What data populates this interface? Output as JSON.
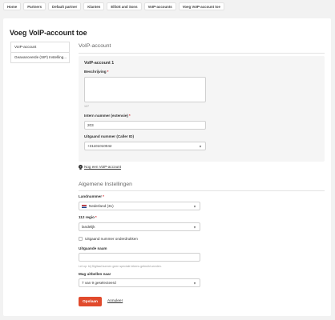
{
  "breadcrumb": [
    "Home",
    "Partners",
    "Default partner",
    "Klanten",
    "Elliott and Sons",
    "VoIP-accounts",
    "Voeg VoIP-account toe"
  ],
  "page_title": "Voeg VoIP-account toe",
  "sidebar": {
    "items": [
      {
        "label": "VoIP-account",
        "active": true
      },
      {
        "label": "Geavanceerde (SIP) Instelling...",
        "active": false
      }
    ]
  },
  "voip_section": {
    "title": "VoIP-account",
    "account_title": "VoIP-account 1",
    "description_label": "Beschrijving",
    "description_value": "",
    "description_count": "127",
    "internal_number_label": "Intern nummer (extensie)",
    "internal_number_value": "203",
    "outgoing_number_label": "Uitgaand nummer (Caller ID)",
    "outgoing_number_value": "+31101010042",
    "add_account_link": "Nog een VoIP-account"
  },
  "general_section": {
    "title": "Algemene Instellingen",
    "country_label": "Landnummer",
    "country_value": "Nederland (31)",
    "rule_112_label": "112 regio",
    "rule_112_value": "landelijk",
    "suppress_label": "Uitgaand nummer onderdrukken",
    "outgoing_name_label": "Uitgaande naam",
    "outgoing_name_value": "",
    "outgoing_name_hint": "Let op: bij Digitaal kunnen geen speciale tekens gebruikt worden.",
    "may_call_label": "Mag uitbellen naar",
    "may_call_value": "7 van 9 geselecteerd"
  },
  "actions": {
    "save_label": "Opslaan",
    "cancel_label": "Annuleer"
  },
  "colors": {
    "primary_button": "#e14a2c",
    "required": "#d2232a"
  }
}
